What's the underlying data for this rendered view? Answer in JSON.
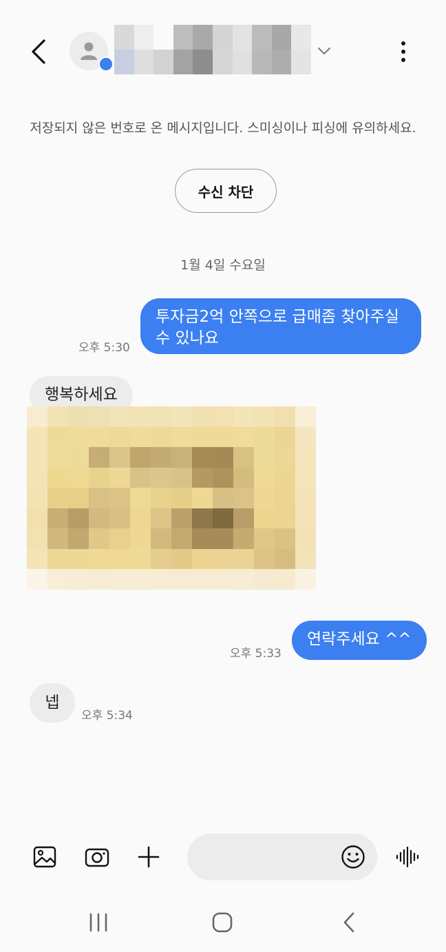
{
  "header": {
    "back_icon": "chevron-left-icon",
    "avatar_icon": "person-icon",
    "more_icon": "vertical-dots-icon",
    "expand_icon": "chevron-down-icon"
  },
  "notice": {
    "text": "저장되지 않은 번호로 온 메시지입니다. 스미싱이나 피싱에 유의하세요.",
    "block_button": "수신 차단"
  },
  "date_separator": "1월 4일 수요일",
  "messages": [
    {
      "direction": "outgoing",
      "text": "투자금2억 안쪽으로 급매좀 찾아주실수 있나요",
      "time": "오후 5:30"
    },
    {
      "direction": "incoming",
      "text": "행복하세요"
    },
    {
      "direction": "incoming",
      "type": "image"
    },
    {
      "direction": "outgoing",
      "text": "연락주세요 ^^",
      "time": "오후 5:33"
    },
    {
      "direction": "incoming",
      "text": "넵",
      "time": "오후 5:34"
    }
  ],
  "composer": {
    "placeholder": "",
    "icons": [
      "gallery-icon",
      "camera-icon",
      "plus-icon",
      "emoji-icon",
      "voice-icon"
    ]
  },
  "navbar": {
    "icons": [
      "recent-apps-icon",
      "home-icon",
      "back-icon"
    ]
  },
  "colors": {
    "accent": "#3b7ff0",
    "incoming_bubble": "#ececec",
    "background": "#fafafa"
  }
}
